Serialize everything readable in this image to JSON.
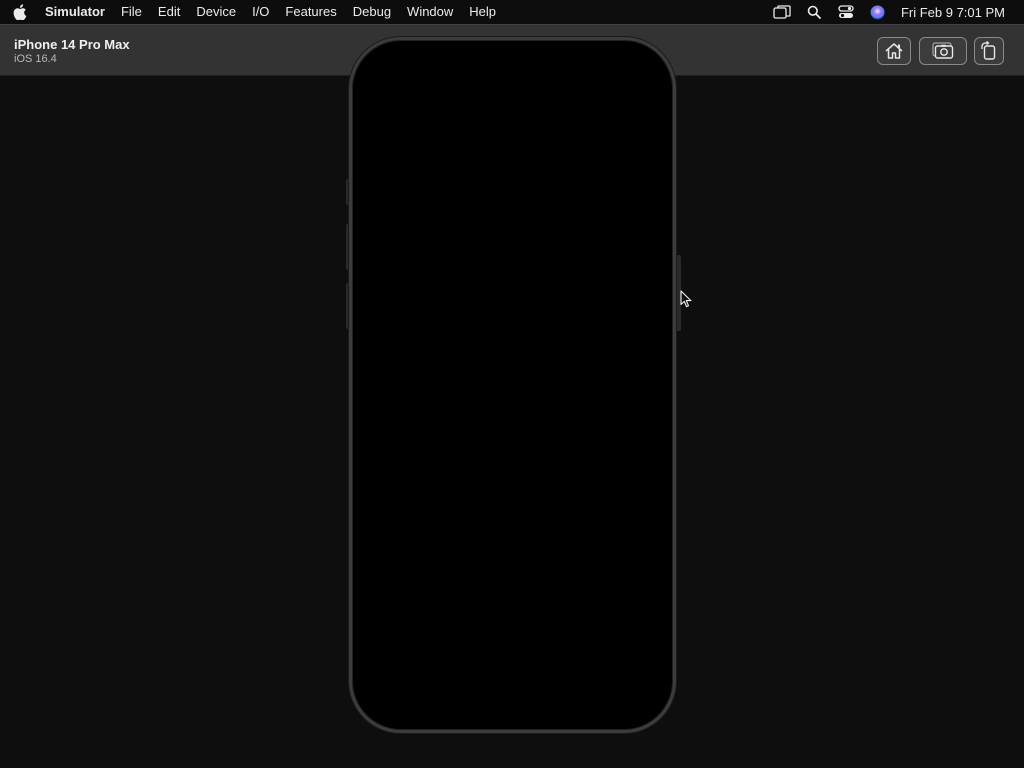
{
  "menubar": {
    "apple_icon": "apple-logo-icon",
    "items": [
      "Simulator",
      "File",
      "Edit",
      "Device",
      "I/O",
      "Features",
      "Debug",
      "Window",
      "Help"
    ],
    "status_icons": [
      "screen-mirroring-icon",
      "spotlight-search-icon",
      "control-center-icon",
      "siri-icon"
    ],
    "clock": "Fri Feb 9  7:01 PM"
  },
  "window": {
    "device_name": "iPhone 14 Pro Max",
    "os_version": "iOS 16.4",
    "toolbar_buttons": {
      "home": "home-icon",
      "screenshot": "screenshot-camera-icon",
      "rotate": "rotate-icon"
    }
  },
  "device": {
    "screen_state": "off",
    "frame_color": "#3c3c3c",
    "screen_color": "#000000"
  },
  "colors": {
    "menubar_bg": "#0d0d0d",
    "titlebar_bg": "#333333",
    "stage_bg": "#0e0e0e"
  }
}
